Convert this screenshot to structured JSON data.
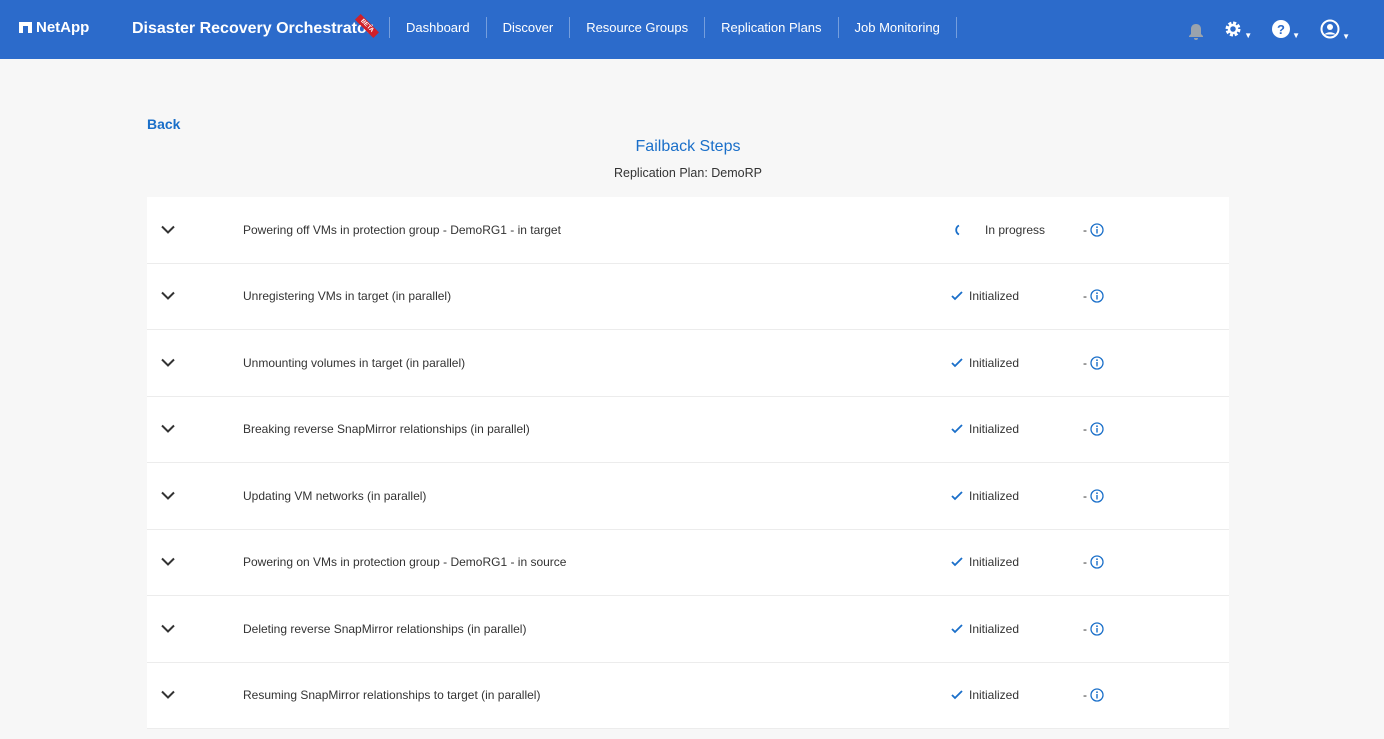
{
  "header": {
    "brand": "NetApp",
    "app_title": "Disaster Recovery Orchestrator",
    "beta": "BETA",
    "nav": [
      "Dashboard",
      "Discover",
      "Resource Groups",
      "Replication Plans",
      "Job Monitoring"
    ],
    "accent": "#2c6bcb"
  },
  "page": {
    "back": "Back",
    "title": "Failback Steps",
    "subtitle": "Replication Plan: DemoRP"
  },
  "steps": [
    {
      "label": "Powering off VMs in protection group - DemoRG1 - in target",
      "status": "In progress",
      "icon": "spinner-icon",
      "extra": "-"
    },
    {
      "label": "Unregistering VMs in target (in parallel)",
      "status": "Initialized",
      "icon": "check-icon",
      "extra": "-"
    },
    {
      "label": "Unmounting volumes in target (in parallel)",
      "status": "Initialized",
      "icon": "check-icon",
      "extra": "-"
    },
    {
      "label": "Breaking reverse SnapMirror relationships (in parallel)",
      "status": "Initialized",
      "icon": "check-icon",
      "extra": "-"
    },
    {
      "label": "Updating VM networks (in parallel)",
      "status": "Initialized",
      "icon": "check-icon",
      "extra": "-"
    },
    {
      "label": "Powering on VMs in protection group - DemoRG1 - in source",
      "status": "Initialized",
      "icon": "check-icon",
      "extra": "-"
    },
    {
      "label": "Deleting reverse SnapMirror relationships (in parallel)",
      "status": "Initialized",
      "icon": "check-icon",
      "extra": "-"
    },
    {
      "label": "Resuming SnapMirror relationships to target (in parallel)",
      "status": "Initialized",
      "icon": "check-icon",
      "extra": "-"
    }
  ]
}
